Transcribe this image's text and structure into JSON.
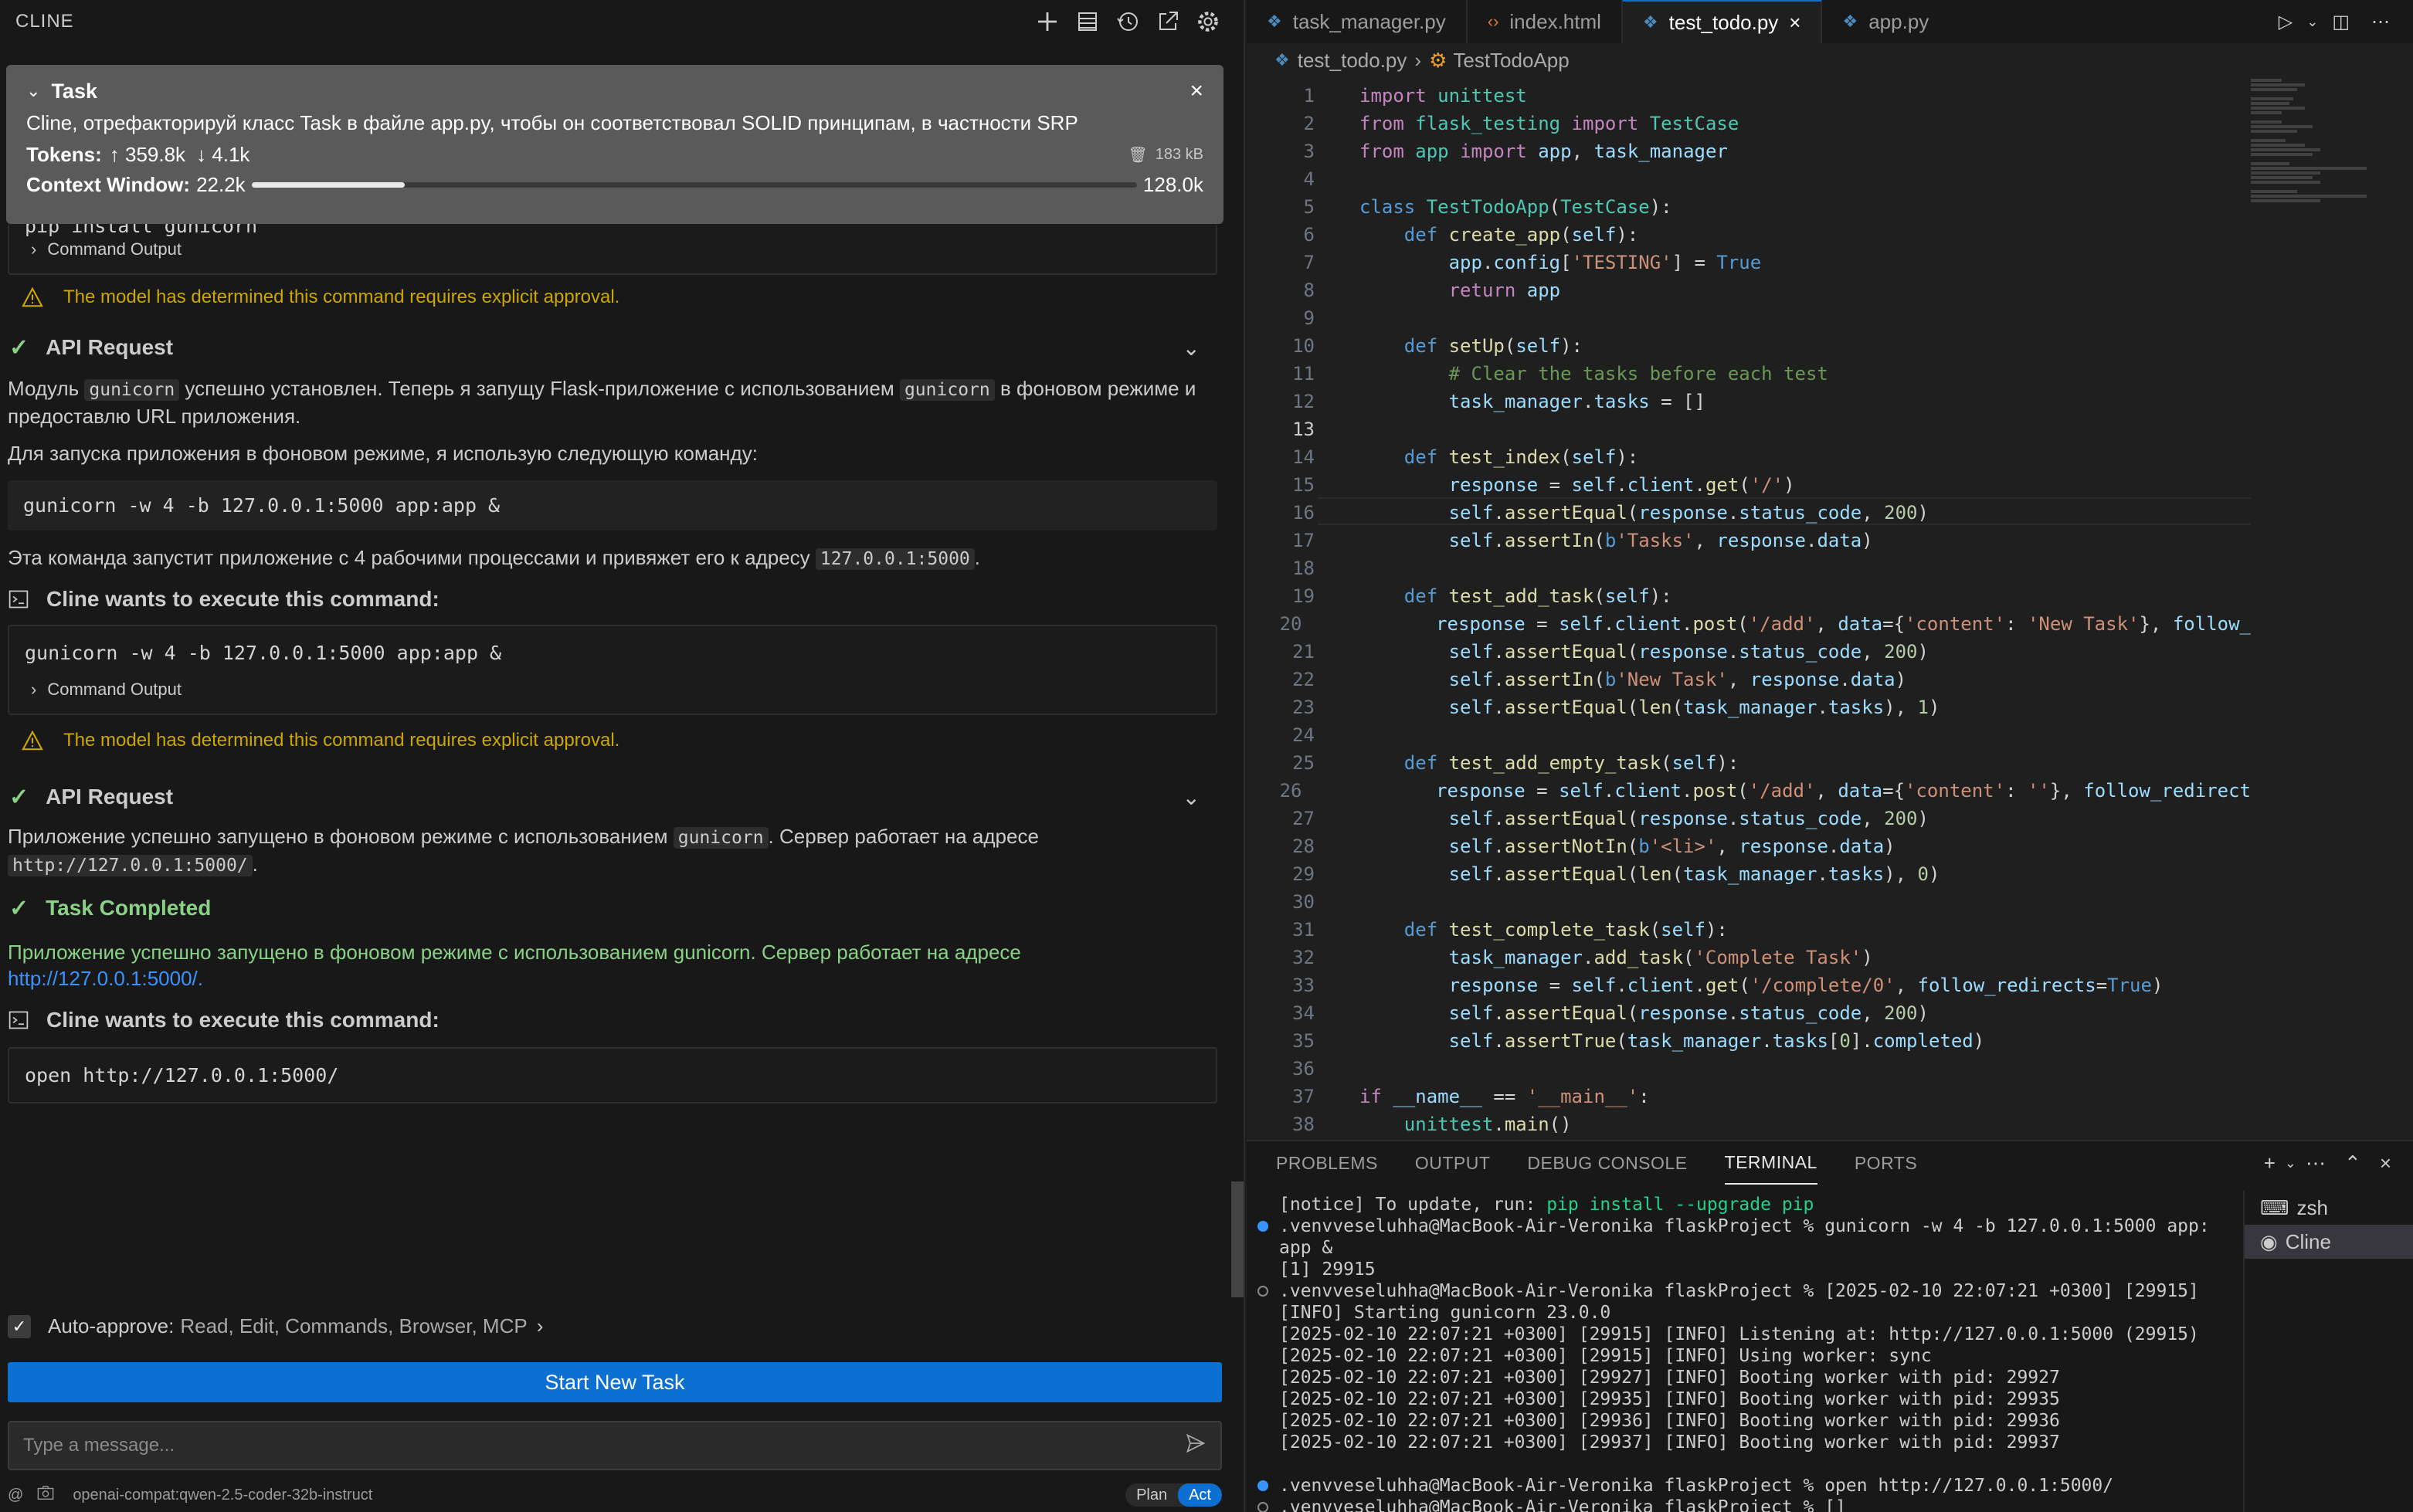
{
  "cline": {
    "title": "CLINE",
    "task": {
      "label": "Task",
      "text": "Cline, отрефакторируй класс Task в файле app.py, чтобы он соответствовал SOLID принципам, в частности SRP",
      "tokens_label": "Tokens:",
      "tokens_up": "↑ 359.8k",
      "tokens_down": "↓ 4.1k",
      "size": "183 kB",
      "context_label": "Context Window:",
      "context_used": "22.2k",
      "context_max": "128.0k",
      "context_fraction": 0.173
    },
    "chat": {
      "partial_cmd": "pip install gunicorn",
      "command_output_label": "Command Output",
      "approval_warning": "The model has determined this command requires explicit approval.",
      "api_request_label": "API Request",
      "msg1_a": "Модуль ",
      "msg1_code1": "gunicorn",
      "msg1_b": " успешно установлен. Теперь я запущу Flask-приложение с использованием ",
      "msg1_code2": "gunicorn",
      "msg1_c": " в фоновом режиме и предоставлю URL приложения.",
      "msg2": "Для запуска приложения в фоновом режиме, я использую следующую команду:",
      "cmd1": "gunicorn -w 4 -b 127.0.0.1:5000 app:app &",
      "msg3_a": "Эта команда запустит приложение с 4 рабочими процессами и привяжет его к адресу ",
      "msg3_code": "127.0.0.1:5000",
      "msg3_b": ".",
      "exec_label": "Cline wants to execute this command:",
      "msg4_a": "Приложение успешно запущено в фоновом режиме с использованием ",
      "msg4_code": "gunicorn",
      "msg4_b": ". Сервер работает на адресе ",
      "msg4_code2": "http://127.0.0.1:5000/",
      "msg4_c": ".",
      "task_completed_label": "Task Completed",
      "completed_text": "Приложение успешно запущено в фоновом режиме с использованием gunicorn. Сервер работает на адресе",
      "completed_link": "http://127.0.0.1:5000/.",
      "cmd2": "open http://127.0.0.1:5000/"
    },
    "auto_approve": {
      "label": "Auto-approve:",
      "values": "Read, Edit, Commands, Browser, MCP"
    },
    "start_new_task": "Start New Task",
    "input_placeholder": "Type a message...",
    "model": "openai-compat:qwen-2.5-coder-32b-instruct",
    "mode": {
      "plan": "Plan",
      "act": "Act"
    }
  },
  "editor": {
    "tabs": [
      {
        "label": "task_manager.py",
        "icon": "python-icon"
      },
      {
        "label": "index.html",
        "icon": "html-icon"
      },
      {
        "label": "test_todo.py",
        "icon": "python-icon",
        "active": true
      },
      {
        "label": "app.py",
        "icon": "python-icon"
      }
    ],
    "breadcrumb": {
      "file": "test_todo.py",
      "symbol": "TestTodoApp"
    },
    "current_line": 13
  },
  "panel": {
    "tabs": [
      "PROBLEMS",
      "OUTPUT",
      "DEBUG CONSOLE",
      "TERMINAL",
      "PORTS"
    ],
    "active_tab": "TERMINAL",
    "terminals": [
      "zsh",
      "Cline"
    ],
    "lines": [
      {
        "dot": "",
        "text": "[notice] To update, run: ",
        "green": "pip install --upgrade pip"
      },
      {
        "dot": "blue",
        "text": ".venvveseluhha@MacBook-Air-Veronika flaskProject % gunicorn -w 4 -b 127.0.0.1:5000 app:"
      },
      {
        "dot": "",
        "text": "app &"
      },
      {
        "dot": "",
        "text": "[1] 29915"
      },
      {
        "dot": "hollow",
        "text": ".venvveseluhha@MacBook-Air-Veronika flaskProject % [2025-02-10 22:07:21 +0300] [29915]"
      },
      {
        "dot": "",
        "text": "[INFO] Starting gunicorn 23.0.0"
      },
      {
        "dot": "",
        "text": "[2025-02-10 22:07:21 +0300] [29915] [INFO] Listening at: http://127.0.0.1:5000 (29915)"
      },
      {
        "dot": "",
        "text": "[2025-02-10 22:07:21 +0300] [29915] [INFO] Using worker: sync"
      },
      {
        "dot": "",
        "text": "[2025-02-10 22:07:21 +0300] [29927] [INFO] Booting worker with pid: 29927"
      },
      {
        "dot": "",
        "text": "[2025-02-10 22:07:21 +0300] [29935] [INFO] Booting worker with pid: 29935"
      },
      {
        "dot": "",
        "text": "[2025-02-10 22:07:21 +0300] [29936] [INFO] Booting worker with pid: 29936"
      },
      {
        "dot": "",
        "text": "[2025-02-10 22:07:21 +0300] [29937] [INFO] Booting worker with pid: 29937"
      },
      {
        "dot": "",
        "text": ""
      },
      {
        "dot": "blue",
        "text": ".venvveseluhha@MacBook-Air-Veronika flaskProject % open http://127.0.0.1:5000/"
      },
      {
        "dot": "hollow",
        "text": ".venvveseluhha@MacBook-Air-Veronika flaskProject % []"
      }
    ]
  }
}
